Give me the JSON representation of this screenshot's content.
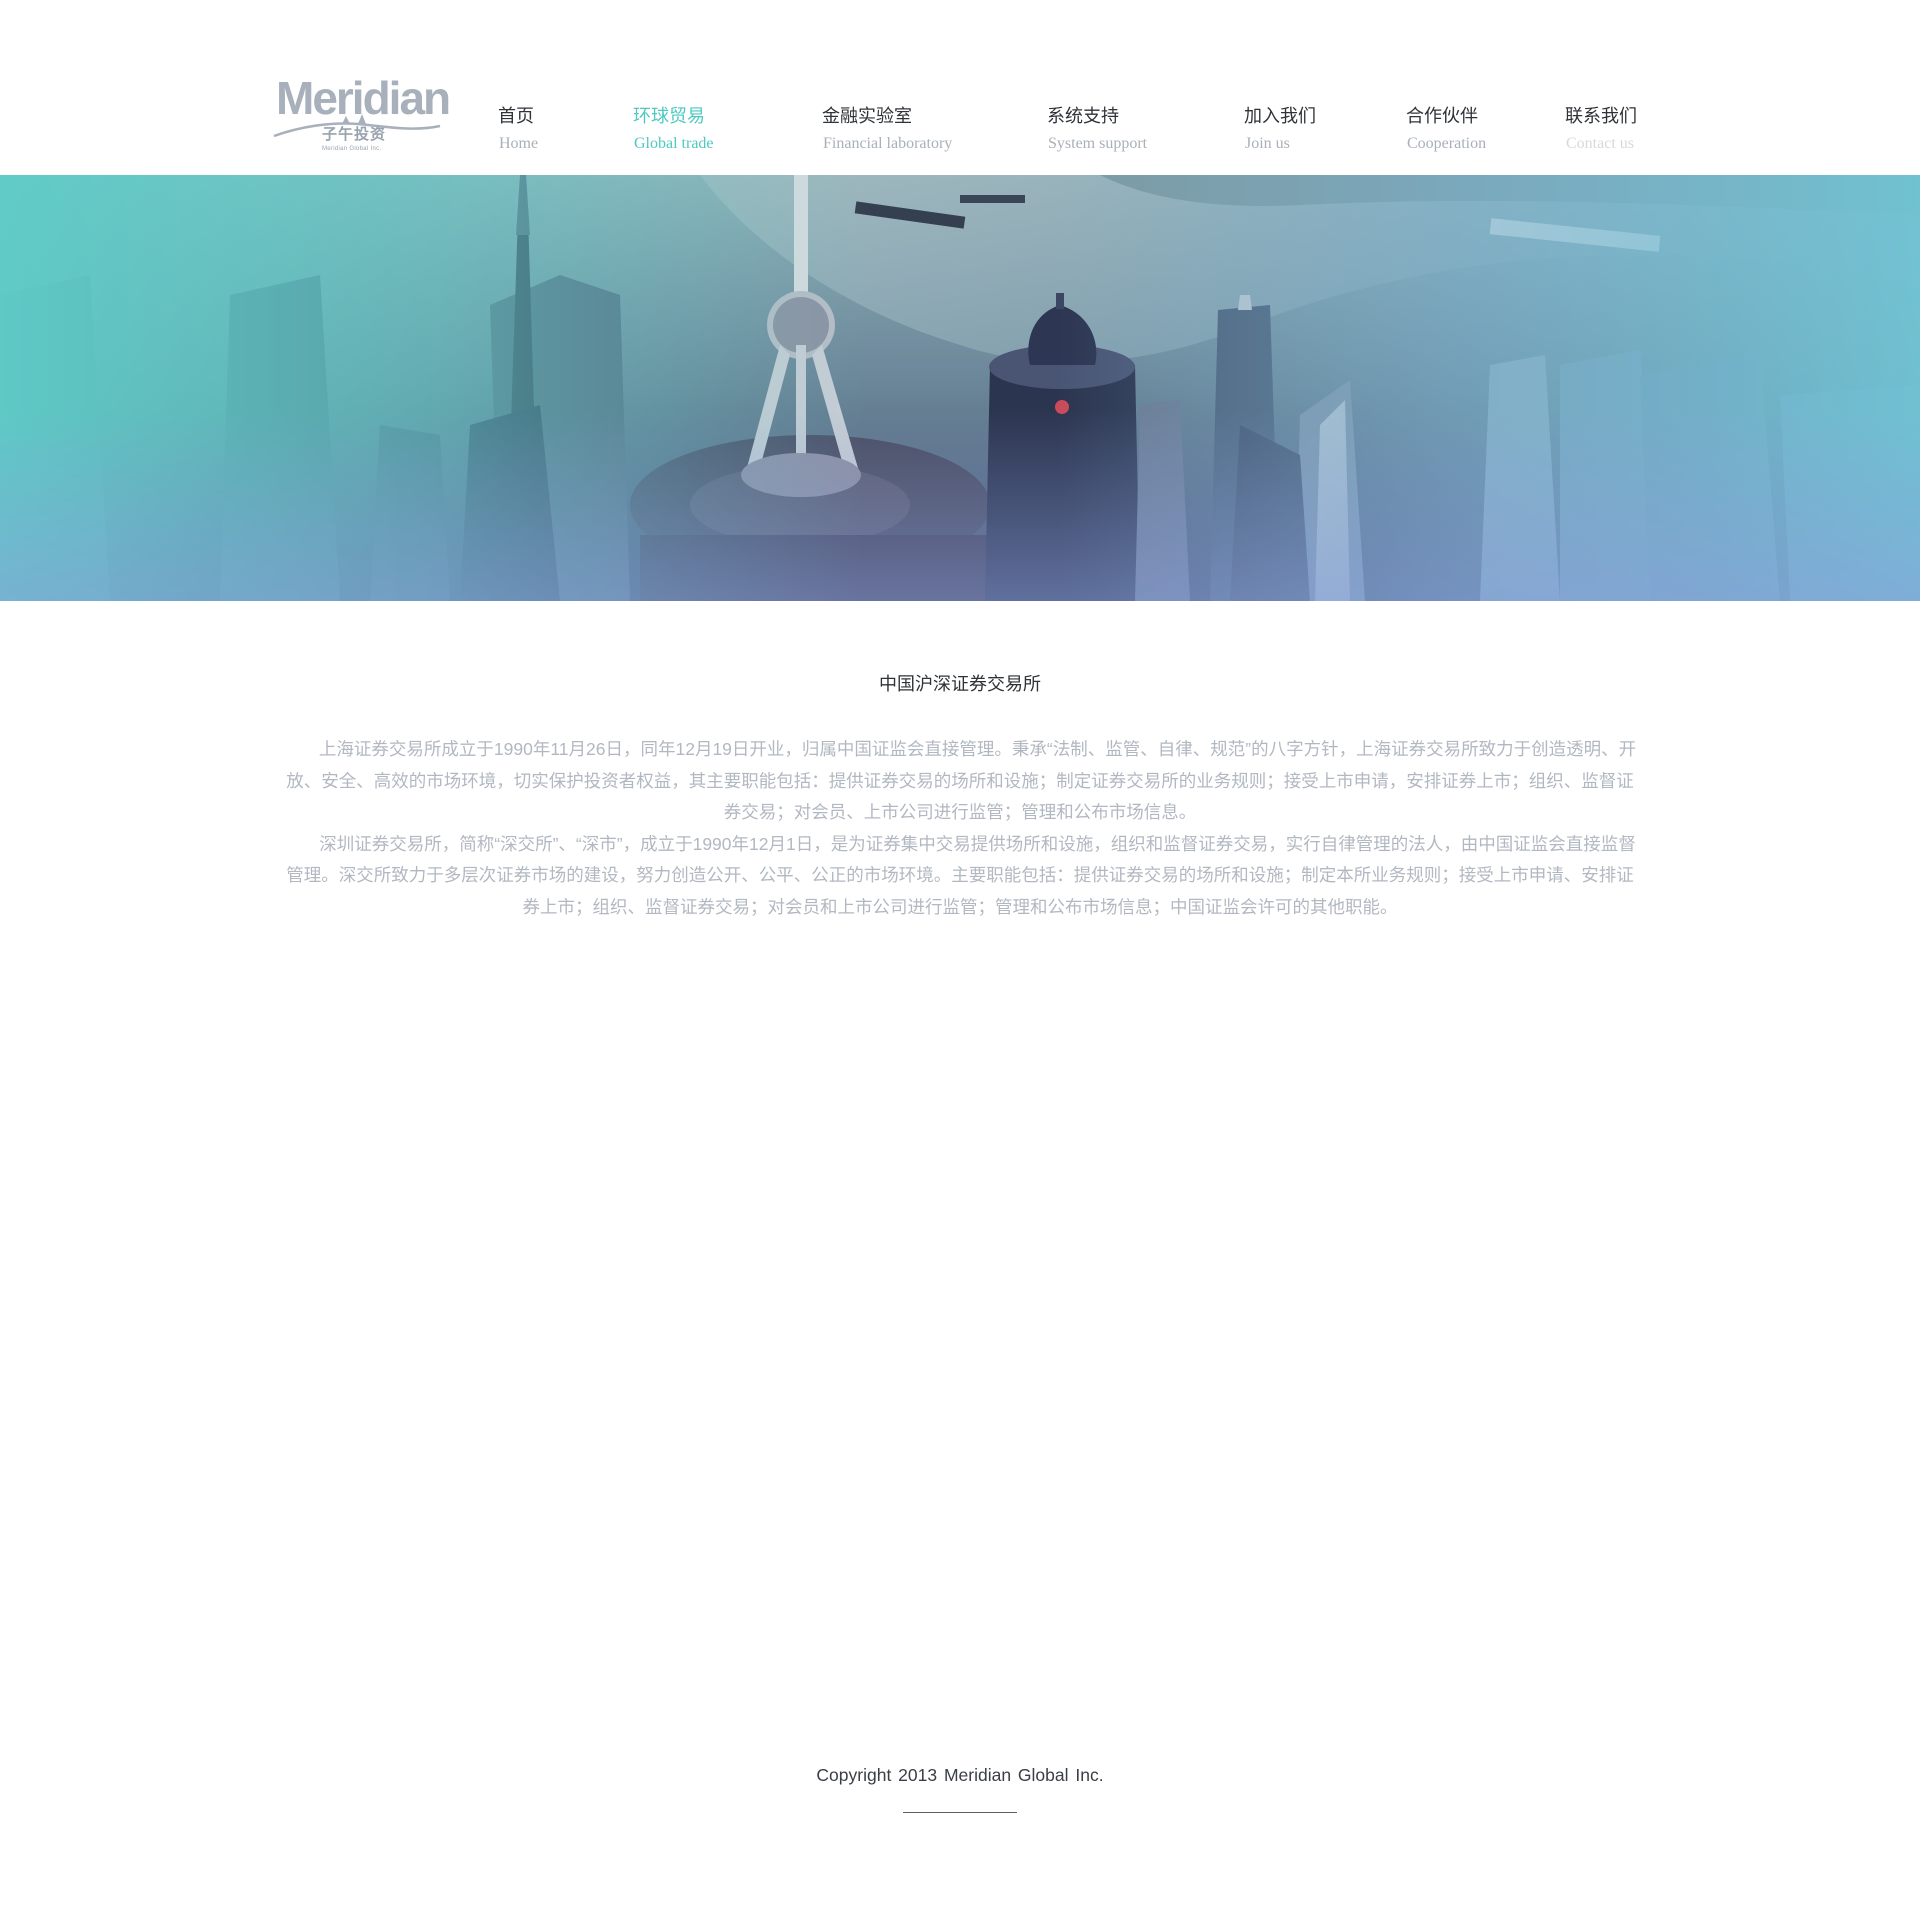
{
  "brand": {
    "name": "Meridian",
    "chinese_name": "子午投资",
    "subtitle": "Meridian Global Inc."
  },
  "nav": [
    {
      "label_cn": "首页",
      "label_en": "Home",
      "active": false
    },
    {
      "label_cn": "环球贸易",
      "label_en": "Global trade",
      "active": true
    },
    {
      "label_cn": "金融实验室",
      "label_en": "Financial laboratory",
      "active": false
    },
    {
      "label_cn": "系统支持",
      "label_en": "System support",
      "active": false
    },
    {
      "label_cn": "加入我们",
      "label_en": "Join us",
      "active": false
    },
    {
      "label_cn": "合作伙伴",
      "label_en": "Cooperation",
      "active": false
    },
    {
      "label_cn": "联系我们",
      "label_en": "Contact us",
      "active": false
    }
  ],
  "banner": {
    "description": "",
    "gradient_colors": [
      "#5ecdc8",
      "#8a9fdc"
    ]
  },
  "content": {
    "title": "中国沪深证券交易所",
    "paragraphs": [
      "上海证券交易所成立于1990年11月26日，同年12月19日开业，归属中国证监会直接管理。秉承“法制、监管、自律、规范”的八字方针，上海证券交易所致力于创造透明、开放、安全、高效的市场环境，切实保护投资者权益，其主要职能包括：提供证券交易的场所和设施；制定证券交易所的业务规则；接受上市申请，安排证券上市；组织、监督证券交易；对会员、上市公司进行监管；管理和公布市场信息。",
      "深圳证券交易所，简称“深交所”、“深市”，成立于1990年12月1日，是为证券集中交易提供场所和设施，组织和监督证券交易，实行自律管理的法人，由中国证监会直接监督管理。深交所致力于多层次证券市场的建设，努力创造公开、公平、公正的市场环境。主要职能包括：提供证券交易的场所和设施；制定本所业务规则；接受上市申请、安排证券上市；组织、监督证券交易；对会员和上市公司进行监管；管理和公布市场信息；中国证监会许可的其他职能。"
    ]
  },
  "footer": {
    "copyright": "Copyright 2013   Meridian Global Inc."
  },
  "colors": {
    "accent": "#4ec9c1",
    "text_dark": "#2f3338",
    "text_muted": "#b2b8c1",
    "nav_en": "#a9b0b8"
  }
}
